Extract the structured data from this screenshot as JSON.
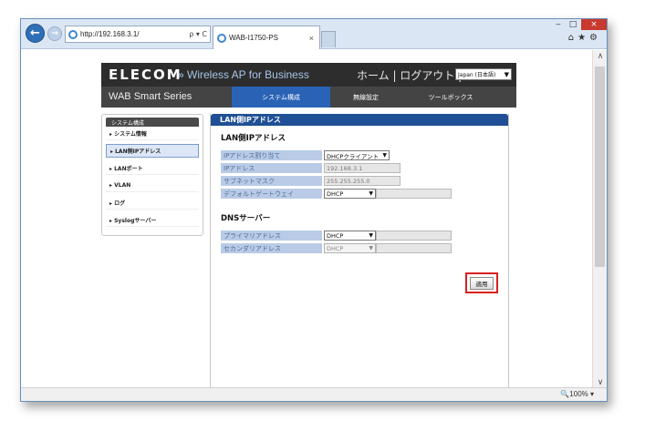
{
  "browser": {
    "address_url": "http://192.168.3.1/",
    "address_tools": "ρ ▾ C",
    "tab_title": "WAB-I1750-PS",
    "tab_close": "×",
    "zoom": "🔍100%  ▾",
    "window_min": "‒",
    "window_max": "□",
    "window_close": "×",
    "toolbar_icons": "⌂★⚙"
  },
  "header": {
    "logo": "ELECOM",
    "product": "» Wireless AP for Business",
    "links": "ホーム | ログアウト |",
    "language": "Japan (日本語)"
  },
  "nav": {
    "series": "WAB Smart Series",
    "tabs": [
      {
        "label": "システム構成"
      },
      {
        "label": "無線設定"
      },
      {
        "label": "ツールボックス"
      }
    ]
  },
  "sidebar": {
    "title": "システム構成",
    "items": [
      {
        "label": "▸ システム情報"
      },
      {
        "label": "▸ LAN側IPアドレス"
      },
      {
        "label": "▸ LANポート"
      },
      {
        "label": "▸ VLAN"
      },
      {
        "label": "▸ ログ"
      },
      {
        "label": "▸ Syslogサーバー"
      }
    ]
  },
  "content": {
    "header": "LAN側IPアドレス",
    "lan_section": "LAN側IPアドレス",
    "dns_section": "DNSサーバー",
    "fields": {
      "ip_assign_label": "IPアドレス割り当て",
      "ip_assign_value": "DHCPクライアント",
      "ip_label": "IPアドレス",
      "ip_value": "192.168.3.1",
      "mask_label": "サブネットマスク",
      "mask_value": "255.255.255.0",
      "gateway_label": "デフォルトゲートウェイ",
      "gateway_value": "DHCP",
      "dns1_label": "プライマリアドレス",
      "dns1_value": "DHCP",
      "dns2_label": "セカンダリアドレス",
      "dns2_value": "DHCP"
    },
    "apply_label": "適用"
  }
}
